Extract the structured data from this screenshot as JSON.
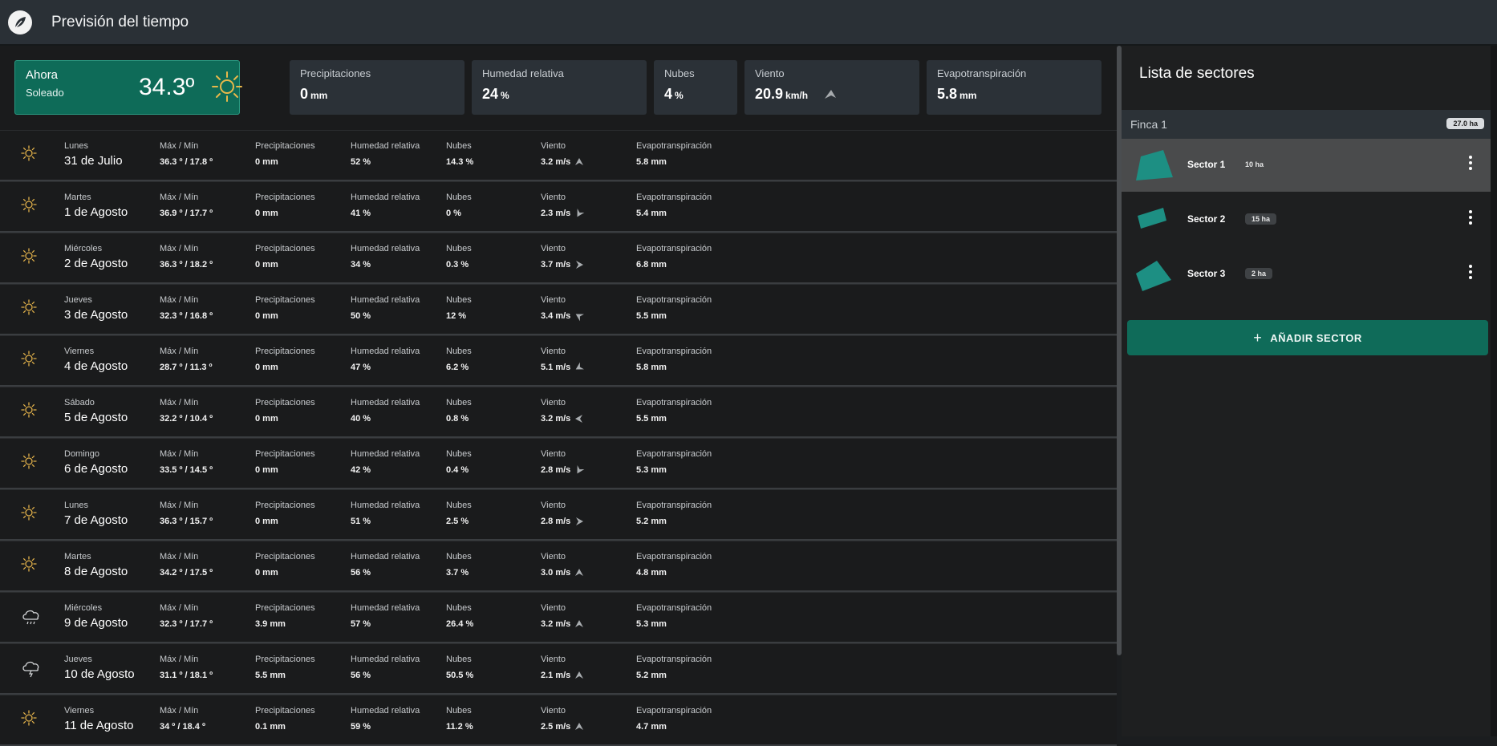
{
  "app": {
    "title": "Previsión del tiempo"
  },
  "current": {
    "now_label": "Ahora",
    "condition": "Soleado",
    "temperature": "34.3º",
    "icon": "sun-icon",
    "precip_label": "Precipitaciones",
    "precip_value": "0",
    "precip_unit": "mm",
    "humidity_label": "Humedad relativa",
    "humidity_value": "24",
    "humidity_unit": "%",
    "clouds_label": "Nubes",
    "clouds_value": "4",
    "clouds_unit": "%",
    "wind_label": "Viento",
    "wind_value": "20.9",
    "wind_unit": "km/h",
    "evap_label": "Evapotranspiración",
    "evap_value": "5.8",
    "evap_unit": "mm"
  },
  "forecast_labels": {
    "maxmin": "Máx / Mín",
    "precip": "Precipitaciones",
    "humidity": "Humedad relativa",
    "clouds": "Nubes",
    "wind": "Viento",
    "evap": "Evapotranspiración"
  },
  "forecast": [
    {
      "day": "Lunes",
      "date": "31 de Julio",
      "maxmin": "36.3 º / 17.8 º",
      "precip": "0 mm",
      "humidity": "52 %",
      "clouds": "14.3 %",
      "wind": "3.2 m/s",
      "wind_dir": 90,
      "evap": "5.8 mm",
      "icon": "sun-icon"
    },
    {
      "day": "Martes",
      "date": "1 de Agosto",
      "maxmin": "36.9 º / 17.7 º",
      "precip": "0 mm",
      "humidity": "41 %",
      "clouds": "0 %",
      "wind": "2.3 m/s",
      "wind_dir": -60,
      "evap": "5.4 mm",
      "icon": "sun-icon"
    },
    {
      "day": "Miércoles",
      "date": "2 de Agosto",
      "maxmin": "36.3 º / 18.2 º",
      "precip": "0 mm",
      "humidity": "34 %",
      "clouds": "0.3 %",
      "wind": "3.7 m/s",
      "wind_dir": 180,
      "evap": "6.8 mm",
      "icon": "sun-icon"
    },
    {
      "day": "Jueves",
      "date": "3 de Agosto",
      "maxmin": "32.3 º / 16.8 º",
      "precip": "0 mm",
      "humidity": "50 %",
      "clouds": "12 %",
      "wind": "3.4 m/s",
      "wind_dir": 30,
      "evap": "5.5 mm",
      "icon": "sun-icon"
    },
    {
      "day": "Viernes",
      "date": "4 de Agosto",
      "maxmin": "28.7 º / 11.3 º",
      "precip": "0 mm",
      "humidity": "47 %",
      "clouds": "6.2 %",
      "wind": "5.1 m/s",
      "wind_dir": -30,
      "evap": "5.8 mm",
      "icon": "sun-icon"
    },
    {
      "day": "Sábado",
      "date": "5 de Agosto",
      "maxmin": "32.2 º / 10.4 º",
      "precip": "0 mm",
      "humidity": "40 %",
      "clouds": "0.8 %",
      "wind": "3.2 m/s",
      "wind_dir": 0,
      "evap": "5.5 mm",
      "icon": "sun-icon"
    },
    {
      "day": "Domingo",
      "date": "6 de Agosto",
      "maxmin": "33.5 º / 14.5 º",
      "precip": "0 mm",
      "humidity": "42 %",
      "clouds": "0.4 %",
      "wind": "2.8 m/s",
      "wind_dir": -60,
      "evap": "5.3 mm",
      "icon": "sun-icon"
    },
    {
      "day": "Lunes",
      "date": "7 de Agosto",
      "maxmin": "36.3 º / 15.7 º",
      "precip": "0 mm",
      "humidity": "51 %",
      "clouds": "2.5 %",
      "wind": "2.8 m/s",
      "wind_dir": 180,
      "evap": "5.2 mm",
      "icon": "sun-icon"
    },
    {
      "day": "Martes",
      "date": "8 de Agosto",
      "maxmin": "34.2 º / 17.5 º",
      "precip": "0 mm",
      "humidity": "56 %",
      "clouds": "3.7 %",
      "wind": "3.0 m/s",
      "wind_dir": 90,
      "evap": "4.8 mm",
      "icon": "sun-icon"
    },
    {
      "day": "Miércoles",
      "date": "9 de Agosto",
      "maxmin": "32.3 º / 17.7 º",
      "precip": "3.9 mm",
      "humidity": "57 %",
      "clouds": "26.4 %",
      "wind": "3.2 m/s",
      "wind_dir": 90,
      "evap": "5.3 mm",
      "icon": "rain-cloud-icon"
    },
    {
      "day": "Jueves",
      "date": "10 de Agosto",
      "maxmin": "31.1 º / 18.1 º",
      "precip": "5.5 mm",
      "humidity": "56 %",
      "clouds": "50.5 %",
      "wind": "2.1 m/s",
      "wind_dir": 90,
      "evap": "5.2 mm",
      "icon": "storm-cloud-icon"
    },
    {
      "day": "Viernes",
      "date": "11 de Agosto",
      "maxmin": "34 º / 18.4 º",
      "precip": "0.1 mm",
      "humidity": "59 %",
      "clouds": "11.2 %",
      "wind": "2.5 m/s",
      "wind_dir": 90,
      "evap": "4.7 mm",
      "icon": "sun-icon"
    }
  ],
  "sidebar": {
    "title": "Lista de sectores",
    "farm": {
      "name": "Finca 1",
      "area": "27.0 ha"
    },
    "sectors": [
      {
        "name": "Sector 1",
        "area": "10 ha"
      },
      {
        "name": "Sector 2",
        "area": "15 ha"
      },
      {
        "name": "Sector 3",
        "area": "2 ha"
      }
    ],
    "add_button": "AÑADIR SECTOR"
  },
  "colors": {
    "accent": "#0f6b59",
    "topbar": "#2a3036",
    "card": "#2b3137",
    "sector_shape": "#1d8f83"
  }
}
